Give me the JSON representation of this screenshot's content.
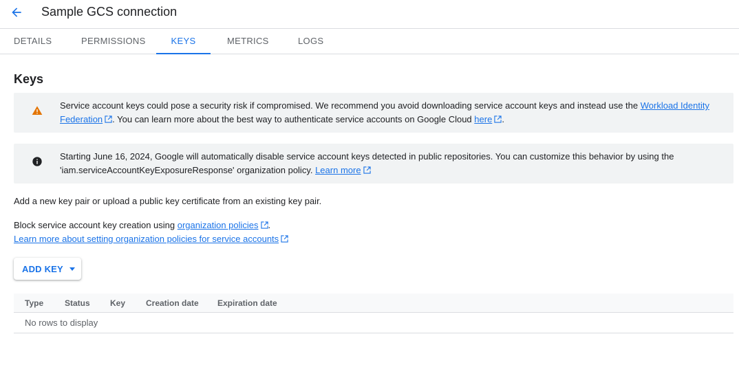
{
  "header": {
    "title": "Sample GCS connection",
    "back_icon": "arrow-back-icon"
  },
  "tabs": [
    {
      "label": "DETAILS",
      "active": false
    },
    {
      "label": "PERMISSIONS",
      "active": false
    },
    {
      "label": "KEYS",
      "active": true
    },
    {
      "label": "METRICS",
      "active": false
    },
    {
      "label": "LOGS",
      "active": false
    }
  ],
  "section_title": "Keys",
  "warning_notice": {
    "icon": "warning-icon",
    "text_1": "Service account keys could pose a security risk if compromised. We recommend you avoid downloading service account keys and instead use the ",
    "link_1": "Workload Identity Federation",
    "text_2": ". You can learn more about the best way to authenticate service accounts on Google Cloud ",
    "link_2": "here",
    "text_3": "."
  },
  "info_notice": {
    "icon": "info-icon",
    "text_1": "Starting June 16, 2024, Google will automatically disable service account keys detected in public repositories. You can customize this behavior by using the 'iam.serviceAccountKeyExposureResponse' organization policy. ",
    "link_1": "Learn more"
  },
  "add_key_text": "Add a new key pair or upload a public key certificate from an existing key pair.",
  "block_text": {
    "prefix": "Block service account key creation using ",
    "link": "organization policies",
    "suffix": "."
  },
  "learn_more_link": "Learn more about setting organization policies for service accounts",
  "add_key_button": "ADD KEY",
  "table": {
    "columns": [
      "Type",
      "Status",
      "Key",
      "Creation date",
      "Expiration date"
    ],
    "empty_message": "No rows to display"
  },
  "colors": {
    "accent": "#1a73e8",
    "warning": "#e37400",
    "notice_bg": "#f1f3f4"
  }
}
